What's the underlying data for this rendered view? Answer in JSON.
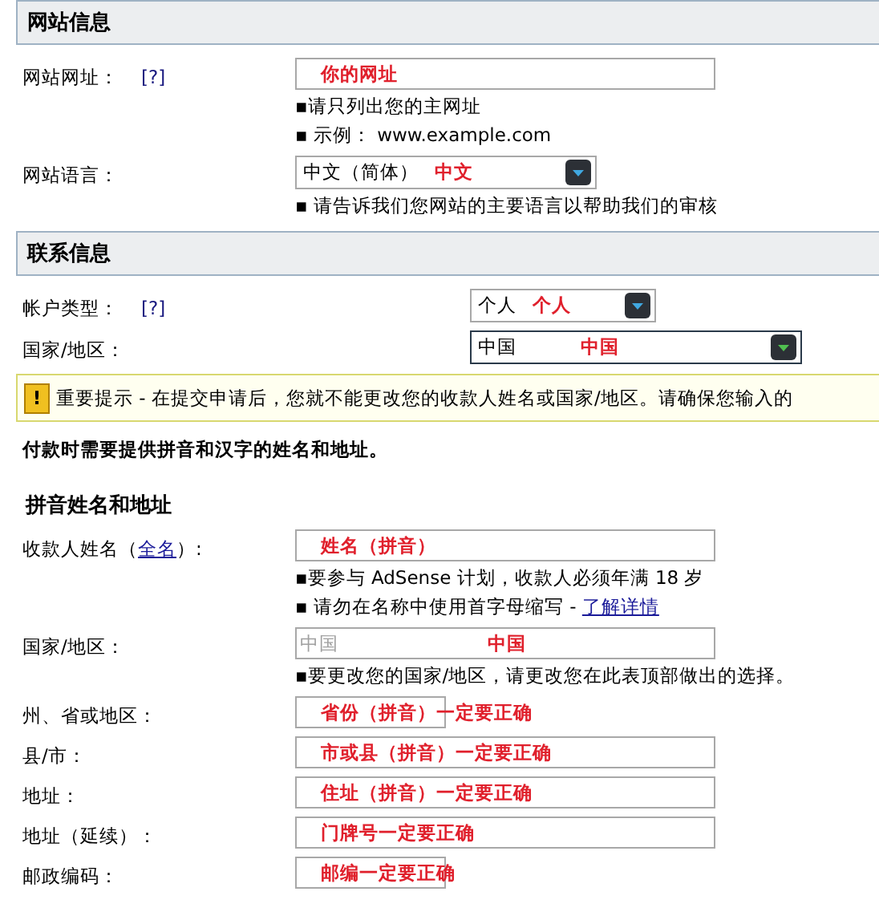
{
  "sections": [
    {
      "kind": "boxed",
      "title": "网站信息",
      "fields": [
        {
          "label": "网站网址：",
          "help": "[?]",
          "control": {
            "kind": "input",
            "annotation": "你的网址"
          },
          "hints": [
            {
              "text": "▪请只列出您的主网址"
            },
            {
              "text": "▪ 示例：   www.example.com"
            }
          ]
        },
        {
          "label": "网站语言：",
          "control": {
            "kind": "select",
            "value": "中文（简体）",
            "annotation": "中文"
          },
          "hints": [
            {
              "text": "▪ 请告诉我们您网站的主要语言以帮助我们的审核"
            }
          ]
        }
      ]
    },
    {
      "kind": "boxed-wide",
      "title": "联系信息",
      "fields": [
        {
          "label": "帐户类型：",
          "help": "[?]",
          "control": {
            "kind": "select",
            "value": "个人",
            "annotation": "个人"
          }
        },
        {
          "label": "国家/地区：",
          "control": {
            "kind": "wide-select",
            "value": "中国",
            "annotation": "中国"
          }
        }
      ],
      "notice": {
        "icon": "!",
        "text": "重要提示 - 在提交申请后，您就不能更改您的收款人姓名或国家/地区。请确保您输入的"
      },
      "note": "付款时需要提供拼音和汉字的姓名和地址。"
    },
    {
      "kind": "plain",
      "title": "拼音姓名和地址",
      "fields": [
        {
          "label": "收款人姓名（",
          "label_link": "全名",
          "label_after": "）:",
          "control": {
            "kind": "input",
            "annotation": "姓名（拼音）"
          },
          "hints": [
            {
              "text": "▪要参与  AdSense 计划，收款人必须年满  18 岁"
            },
            {
              "text": "▪ 请勿在名称中使用首字母缩写  - ",
              "link": "了解详情"
            }
          ]
        },
        {
          "label": "国家/地区：",
          "control": {
            "kind": "input",
            "value": "中国",
            "disabled": true,
            "annotation": "中国"
          },
          "hints": [
            {
              "text": "▪要更改您的国家/地区，请更改您在此表顶部做出的选择。"
            }
          ]
        },
        {
          "label": "州、省或地区：",
          "control": {
            "kind": "short-input",
            "annotation": "省份（拼音）一定要正确"
          }
        },
        {
          "label": "县/市：",
          "control": {
            "kind": "input",
            "annotation": "市或县（拼音）一定要正确"
          }
        },
        {
          "label": "地址：",
          "control": {
            "kind": "input",
            "annotation": "住址（拼音）一定要正确"
          }
        },
        {
          "label": "地址（延续）：",
          "control": {
            "kind": "input",
            "annotation": "门牌号一定要正确"
          }
        },
        {
          "label": "邮政编码：",
          "control": {
            "kind": "short-input",
            "annotation": "邮编一定要正确"
          }
        }
      ]
    }
  ]
}
